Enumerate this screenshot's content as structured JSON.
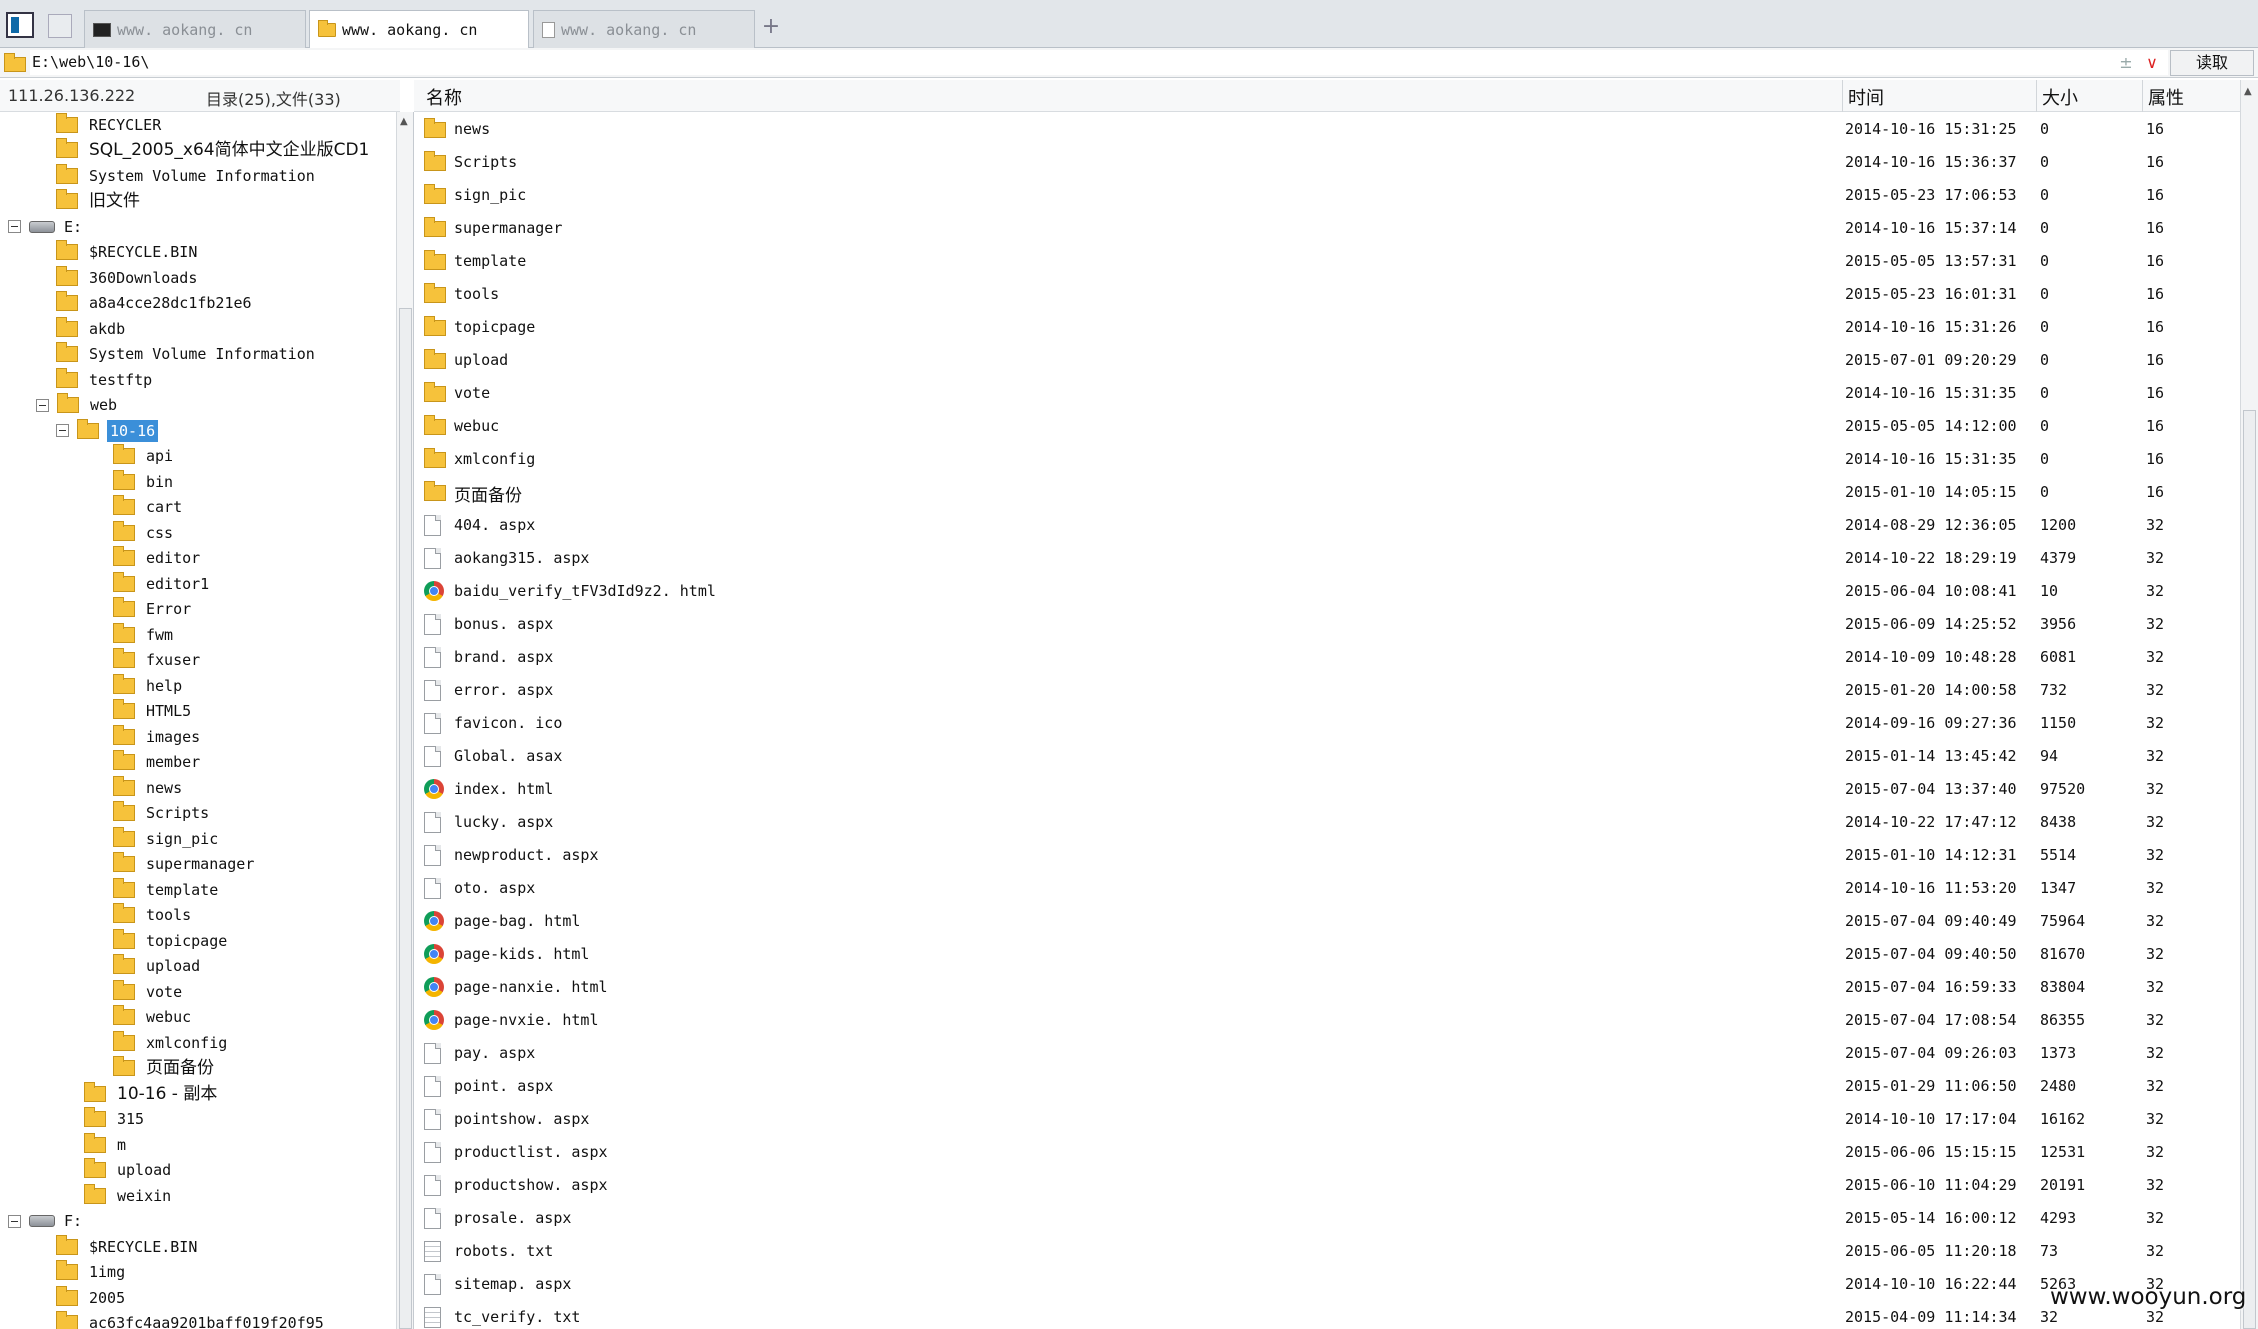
{
  "tabs": [
    {
      "label": "www. aokang. cn",
      "icon": "terminal-icon",
      "active": false
    },
    {
      "label": "www. aokang. cn",
      "icon": "folder-icon",
      "active": true
    },
    {
      "label": "www. aokang. cn",
      "icon": "document-icon",
      "active": false
    }
  ],
  "newtab_label": "+",
  "address": {
    "path": "E:\\web\\10-16\\",
    "pin_glyph": "±",
    "dropdown_glyph": "∨",
    "read_button": "读取"
  },
  "left_info": {
    "ip": "111.26.136.222",
    "counts": "目录(25),文件(33)"
  },
  "columns": {
    "name": "名称",
    "time": "时间",
    "size": "大小",
    "attr": "属性"
  },
  "tree": [
    {
      "label": "RECYCLER",
      "type": "folder",
      "level": 2
    },
    {
      "label": "SQL_2005_x64简体中文企业版CD1",
      "type": "folder",
      "level": 2
    },
    {
      "label": "System Volume Information",
      "type": "folder",
      "level": 2
    },
    {
      "label": "旧文件",
      "type": "folder",
      "level": 2
    },
    {
      "label": "E:",
      "type": "drive",
      "level": 0,
      "expanded": true
    },
    {
      "label": "$RECYCLE.BIN",
      "type": "folder",
      "level": 2
    },
    {
      "label": "360Downloads",
      "type": "folder",
      "level": 2
    },
    {
      "label": "a8a4cce28dc1fb21e6",
      "type": "folder",
      "level": 2
    },
    {
      "label": "akdb",
      "type": "folder",
      "level": 2
    },
    {
      "label": "System Volume Information",
      "type": "folder",
      "level": 2
    },
    {
      "label": "testftp",
      "type": "folder",
      "level": 2
    },
    {
      "label": "web",
      "type": "folder",
      "level": 1,
      "expanded": true
    },
    {
      "label": "10-16",
      "type": "folder",
      "level": 2,
      "expanded": true,
      "selected": true
    },
    {
      "label": "api",
      "type": "folder",
      "level": 4
    },
    {
      "label": "bin",
      "type": "folder",
      "level": 4
    },
    {
      "label": "cart",
      "type": "folder",
      "level": 4
    },
    {
      "label": "css",
      "type": "folder",
      "level": 4
    },
    {
      "label": "editor",
      "type": "folder",
      "level": 4
    },
    {
      "label": "editor1",
      "type": "folder",
      "level": 4
    },
    {
      "label": "Error",
      "type": "folder",
      "level": 4
    },
    {
      "label": "fwm",
      "type": "folder",
      "level": 4
    },
    {
      "label": "fxuser",
      "type": "folder",
      "level": 4
    },
    {
      "label": "help",
      "type": "folder",
      "level": 4
    },
    {
      "label": "HTML5",
      "type": "folder",
      "level": 4
    },
    {
      "label": "images",
      "type": "folder",
      "level": 4
    },
    {
      "label": "member",
      "type": "folder",
      "level": 4
    },
    {
      "label": "news",
      "type": "folder",
      "level": 4
    },
    {
      "label": "Scripts",
      "type": "folder",
      "level": 4
    },
    {
      "label": "sign_pic",
      "type": "folder",
      "level": 4
    },
    {
      "label": "supermanager",
      "type": "folder",
      "level": 4
    },
    {
      "label": "template",
      "type": "folder",
      "level": 4
    },
    {
      "label": "tools",
      "type": "folder",
      "level": 4
    },
    {
      "label": "topicpage",
      "type": "folder",
      "level": 4
    },
    {
      "label": "upload",
      "type": "folder",
      "level": 4
    },
    {
      "label": "vote",
      "type": "folder",
      "level": 4
    },
    {
      "label": "webuc",
      "type": "folder",
      "level": 4
    },
    {
      "label": "xmlconfig",
      "type": "folder",
      "level": 4
    },
    {
      "label": "页面备份",
      "type": "folder",
      "level": 4
    },
    {
      "label": "10-16 - 副本",
      "type": "folder",
      "level": 3
    },
    {
      "label": "315",
      "type": "folder",
      "level": 3
    },
    {
      "label": "m",
      "type": "folder",
      "level": 3
    },
    {
      "label": "upload",
      "type": "folder",
      "level": 3
    },
    {
      "label": "weixin",
      "type": "folder",
      "level": 3
    },
    {
      "label": "F:",
      "type": "drive",
      "level": 0,
      "expanded": true
    },
    {
      "label": "$RECYCLE.BIN",
      "type": "folder",
      "level": 2
    },
    {
      "label": "1img",
      "type": "folder",
      "level": 2
    },
    {
      "label": "2005",
      "type": "folder",
      "level": 2
    },
    {
      "label": "ac63fc4aa9201baff019f20f95",
      "type": "folder",
      "level": 2
    }
  ],
  "files": [
    {
      "name": "news",
      "time": "2014-10-16 15:31:25",
      "size": "0",
      "attr": "16",
      "icon": "folder"
    },
    {
      "name": "Scripts",
      "time": "2014-10-16 15:36:37",
      "size": "0",
      "attr": "16",
      "icon": "folder"
    },
    {
      "name": "sign_pic",
      "time": "2015-05-23 17:06:53",
      "size": "0",
      "attr": "16",
      "icon": "folder"
    },
    {
      "name": "supermanager",
      "time": "2014-10-16 15:37:14",
      "size": "0",
      "attr": "16",
      "icon": "folder"
    },
    {
      "name": "template",
      "time": "2015-05-05 13:57:31",
      "size": "0",
      "attr": "16",
      "icon": "folder"
    },
    {
      "name": "tools",
      "time": "2015-05-23 16:01:31",
      "size": "0",
      "attr": "16",
      "icon": "folder"
    },
    {
      "name": "topicpage",
      "time": "2014-10-16 15:31:26",
      "size": "0",
      "attr": "16",
      "icon": "folder"
    },
    {
      "name": "upload",
      "time": "2015-07-01 09:20:29",
      "size": "0",
      "attr": "16",
      "icon": "folder"
    },
    {
      "name": "vote",
      "time": "2014-10-16 15:31:35",
      "size": "0",
      "attr": "16",
      "icon": "folder"
    },
    {
      "name": "webuc",
      "time": "2015-05-05 14:12:00",
      "size": "0",
      "attr": "16",
      "icon": "folder"
    },
    {
      "name": "xmlconfig",
      "time": "2014-10-16 15:31:35",
      "size": "0",
      "attr": "16",
      "icon": "folder"
    },
    {
      "name": "页面备份",
      "time": "2015-01-10 14:05:15",
      "size": "0",
      "attr": "16",
      "icon": "folder"
    },
    {
      "name": "404. aspx",
      "time": "2014-08-29 12:36:05",
      "size": "1200",
      "attr": "32",
      "icon": "file"
    },
    {
      "name": "aokang315. aspx",
      "time": "2014-10-22 18:29:19",
      "size": "4379",
      "attr": "32",
      "icon": "file"
    },
    {
      "name": "baidu_verify_tFV3dId9z2. html",
      "time": "2015-06-04 10:08:41",
      "size": "10",
      "attr": "32",
      "icon": "chrome"
    },
    {
      "name": "bonus. aspx",
      "time": "2015-06-09 14:25:52",
      "size": "3956",
      "attr": "32",
      "icon": "file"
    },
    {
      "name": "brand. aspx",
      "time": "2014-10-09 10:48:28",
      "size": "6081",
      "attr": "32",
      "icon": "file"
    },
    {
      "name": "error. aspx",
      "time": "2015-01-20 14:00:58",
      "size": "732",
      "attr": "32",
      "icon": "file"
    },
    {
      "name": "favicon. ico",
      "time": "2014-09-16 09:27:36",
      "size": "1150",
      "attr": "32",
      "icon": "file"
    },
    {
      "name": "Global. asax",
      "time": "2015-01-14 13:45:42",
      "size": "94",
      "attr": "32",
      "icon": "file"
    },
    {
      "name": "index. html",
      "time": "2015-07-04 13:37:40",
      "size": "97520",
      "attr": "32",
      "icon": "chrome"
    },
    {
      "name": "lucky. aspx",
      "time": "2014-10-22 17:47:12",
      "size": "8438",
      "attr": "32",
      "icon": "file"
    },
    {
      "name": "newproduct. aspx",
      "time": "2015-01-10 14:12:31",
      "size": "5514",
      "attr": "32",
      "icon": "file"
    },
    {
      "name": "oto. aspx",
      "time": "2014-10-16 11:53:20",
      "size": "1347",
      "attr": "32",
      "icon": "file"
    },
    {
      "name": "page-bag. html",
      "time": "2015-07-04 09:40:49",
      "size": "75964",
      "attr": "32",
      "icon": "chrome"
    },
    {
      "name": "page-kids. html",
      "time": "2015-07-04 09:40:50",
      "size": "81670",
      "attr": "32",
      "icon": "chrome"
    },
    {
      "name": "page-nanxie. html",
      "time": "2015-07-04 16:59:33",
      "size": "83804",
      "attr": "32",
      "icon": "chrome"
    },
    {
      "name": "page-nvxie. html",
      "time": "2015-07-04 17:08:54",
      "size": "86355",
      "attr": "32",
      "icon": "chrome"
    },
    {
      "name": "pay. aspx",
      "time": "2015-07-04 09:26:03",
      "size": "1373",
      "attr": "32",
      "icon": "file"
    },
    {
      "name": "point. aspx",
      "time": "2015-01-29 11:06:50",
      "size": "2480",
      "attr": "32",
      "icon": "file"
    },
    {
      "name": "pointshow. aspx",
      "time": "2014-10-10 17:17:04",
      "size": "16162",
      "attr": "32",
      "icon": "file"
    },
    {
      "name": "productlist. aspx",
      "time": "2015-06-06 15:15:15",
      "size": "12531",
      "attr": "32",
      "icon": "file"
    },
    {
      "name": "productshow. aspx",
      "time": "2015-06-10 11:04:29",
      "size": "20191",
      "attr": "32",
      "icon": "file"
    },
    {
      "name": "prosale. aspx",
      "time": "2015-05-14 16:00:12",
      "size": "4293",
      "attr": "32",
      "icon": "file"
    },
    {
      "name": "robots. txt",
      "time": "2015-06-05 11:20:18",
      "size": "73",
      "attr": "32",
      "icon": "txt"
    },
    {
      "name": "sitemap. aspx",
      "time": "2014-10-10 16:22:44",
      "size": "5263",
      "attr": "32",
      "icon": "file"
    },
    {
      "name": "tc_verify. txt",
      "time": "2015-04-09 11:14:34",
      "size": "32",
      "attr": "32",
      "icon": "txt"
    }
  ],
  "watermark": "www.wooyun.org"
}
